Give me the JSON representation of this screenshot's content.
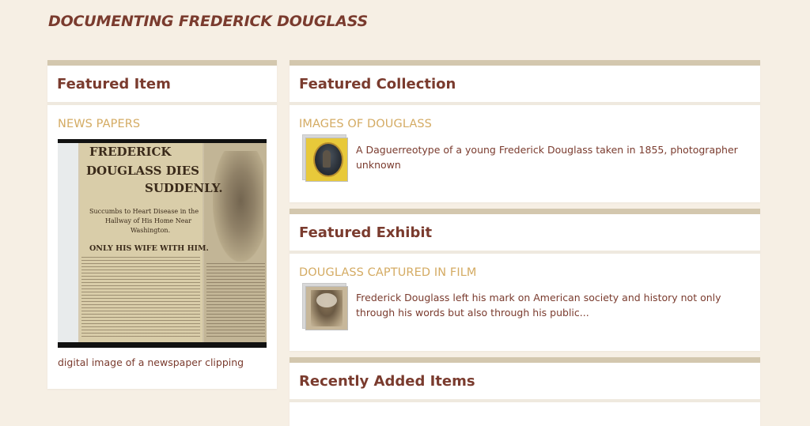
{
  "site": {
    "title": "DOCUMENTING FREDERICK DOUGLASS"
  },
  "featured_item": {
    "heading": "Featured Item",
    "item_title": "NEWS PAPERS",
    "caption": "digital image of a newspaper clipping",
    "clipping_text": {
      "line1": "FREDERICK",
      "line2": "DOUGLASS DIES",
      "line3": "SUDDENLY.",
      "sub1": "Succumbs to Heart Disease in the",
      "sub2": "Hallway of His Home Near",
      "sub3": "Washington.",
      "line4": "ONLY HIS WIFE WITH HIM."
    }
  },
  "featured_collection": {
    "heading": "Featured Collection",
    "item_title": "IMAGES OF DOUGLASS",
    "description": "A Daguerreotype of a young Frederick Douglass taken in 1855, photographer unknown"
  },
  "featured_exhibit": {
    "heading": "Featured Exhibit",
    "item_title": "DOUGLASS CAPTURED IN FILM",
    "description": "Frederick Douglass left his mark on American society and history not only through his words but also through his public..."
  },
  "recently_added": {
    "heading": "Recently Added Items"
  },
  "colors": {
    "background": "#f6efe4",
    "panel_border": "#d3c7ae",
    "heading_text": "#7a3b2e",
    "link_gold": "#d4ab63"
  }
}
